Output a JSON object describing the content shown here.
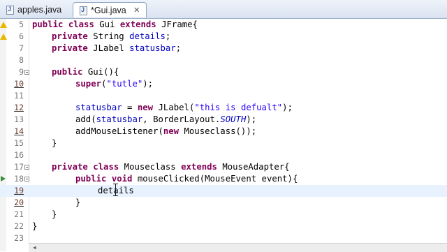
{
  "tabs": [
    {
      "label": "apples.java",
      "active": false,
      "icon": "java-file-icon"
    },
    {
      "label": "*Gui.java",
      "active": true,
      "icon": "java-file-icon",
      "close_icon": "close-icon"
    }
  ],
  "editor": {
    "lines": [
      {
        "num": "5"
      },
      {
        "num": "6"
      },
      {
        "num": "7"
      },
      {
        "num": "8"
      },
      {
        "num": "9"
      },
      {
        "num": "10"
      },
      {
        "num": "11"
      },
      {
        "num": "12"
      },
      {
        "num": "13"
      },
      {
        "num": "14"
      },
      {
        "num": "15"
      },
      {
        "num": "16"
      },
      {
        "num": "17"
      },
      {
        "num": "18"
      },
      {
        "num": "19"
      },
      {
        "num": "20"
      },
      {
        "num": "21"
      },
      {
        "num": "22"
      },
      {
        "num": "23"
      }
    ],
    "code": {
      "l5": [
        "public",
        " ",
        "class",
        " Gui ",
        "extends",
        " JFrame{"
      ],
      "l6": [
        "private",
        " String ",
        "details",
        ";"
      ],
      "l7": [
        "private",
        " JLabel ",
        "statusbar",
        ";"
      ],
      "l9": [
        "public",
        " Gui(){"
      ],
      "l10": [
        "super",
        "(",
        "\"tutle\"",
        ");"
      ],
      "l12": [
        "statusbar",
        " = ",
        "new",
        " JLabel(",
        "\"this is defualt\"",
        ");"
      ],
      "l13": [
        "add(",
        "statusbar",
        ", BorderLayout.",
        "SOUTH",
        ");"
      ],
      "l14": [
        "addMouseListener(",
        "new",
        " Mouseclass());"
      ],
      "l15": [
        "}"
      ],
      "l17": [
        "private",
        " ",
        "class",
        " Mouseclass ",
        "extends",
        " MouseAdapter{"
      ],
      "l18": [
        "public",
        " ",
        "void",
        " mouseClicked(MouseEvent event){"
      ],
      "l19": [
        "details"
      ],
      "l20": [
        "}"
      ],
      "l21": [
        "}"
      ],
      "l22": [
        "}"
      ]
    }
  }
}
